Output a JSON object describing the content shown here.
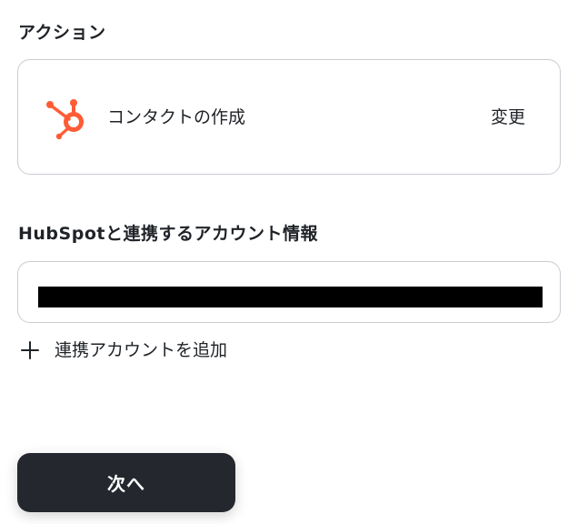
{
  "action_section": {
    "title": "アクション",
    "action": {
      "label": "コンタクトの作成",
      "icon": "hubspot-icon",
      "change_label": "変更"
    }
  },
  "account_section": {
    "title": "HubSpotと連携するアカウント情報",
    "add_account_label": "連携アカウントを追加",
    "add_icon": "plus-icon"
  },
  "footer": {
    "next_label": "次へ"
  },
  "colors": {
    "hubspot_orange": "#ff5c35",
    "button_dark": "#24282e",
    "border": "#c9cdd2",
    "text": "#1f2328"
  }
}
